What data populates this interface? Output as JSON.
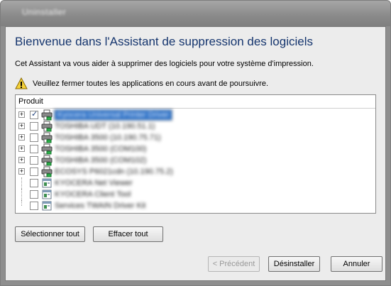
{
  "window": {
    "title": "Uninstaller"
  },
  "heading": "Bienvenue dans l'Assistant de suppression des logiciels",
  "intro": "Cet Assistant va vous aider à supprimer des logiciels pour votre système d'impression.",
  "warning": "Veuillez fermer toutes les applications en cours avant de poursuivre.",
  "list": {
    "header": "Produit",
    "items": [
      {
        "label": "Kyocera Universal Printer Driver",
        "checked": true,
        "expandable": true,
        "icon": "printer-icon"
      },
      {
        "label": "TOSHIBA UDT (10.190.51.1)",
        "checked": false,
        "expandable": true,
        "icon": "printer-icon"
      },
      {
        "label": "TOSHIBA 3500 (10.190.75.71)",
        "checked": false,
        "expandable": true,
        "icon": "printer-icon"
      },
      {
        "label": "TOSHIBA 3500 (COM100)",
        "checked": false,
        "expandable": true,
        "icon": "printer-icon"
      },
      {
        "label": "TOSHIBA 3500 (COM102)",
        "checked": false,
        "expandable": true,
        "icon": "printer-icon"
      },
      {
        "label": "ECOSYS P6021cdn (10.190.75.2)",
        "checked": false,
        "expandable": true,
        "icon": "printer-icon"
      },
      {
        "label": "KYOCERA Net Viewer",
        "checked": false,
        "expandable": false,
        "icon": "app-window-icon"
      },
      {
        "label": "KYOCERA Client Tool",
        "checked": false,
        "expandable": false,
        "icon": "app-window-icon"
      },
      {
        "label": "Services TWAIN Driver Kit",
        "checked": false,
        "expandable": false,
        "icon": "app-window-icon"
      }
    ]
  },
  "buttons": {
    "select_all": "Sélectionner tout",
    "clear_all": "Effacer tout",
    "previous": "< Précédent",
    "uninstall": "Désinstaller",
    "cancel": "Annuler"
  }
}
